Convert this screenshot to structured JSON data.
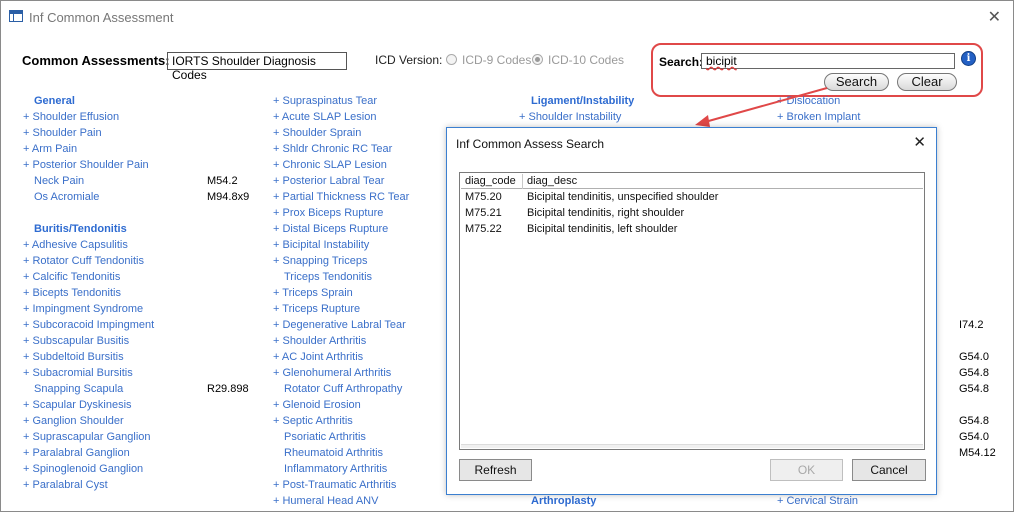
{
  "window": {
    "title": "Inf Common Assessment",
    "close_glyph": "✕"
  },
  "header": {
    "common_label": "Common Assessments:",
    "common_value": "IORTS Shoulder Diagnosis Codes",
    "icd_label": "ICD Version:",
    "icd9_label": "ICD-9 Codes",
    "icd10_label": "ICD-10 Codes",
    "icd_selected": "ICD-10 Codes"
  },
  "search": {
    "label": "Search:",
    "value": "bicipit",
    "info_glyph": "i",
    "search_button": "Search",
    "clear_button": "Clear"
  },
  "col1": [
    {
      "type": "section",
      "text": "General"
    },
    {
      "type": "link",
      "text": "+ Shoulder Effusion"
    },
    {
      "type": "link",
      "text": "+ Shoulder Pain"
    },
    {
      "type": "link",
      "text": "+ Arm Pain"
    },
    {
      "type": "link",
      "text": "+ Posterior Shoulder Pain"
    },
    {
      "type": "item",
      "text": "Neck Pain",
      "code": "M54.2"
    },
    {
      "type": "item",
      "text": "Os Acromiale",
      "code": "M94.8x9"
    },
    {
      "type": "blank",
      "text": ""
    },
    {
      "type": "section",
      "text": "Buritis/Tendonitis"
    },
    {
      "type": "link",
      "text": "+ Adhesive Capsulitis"
    },
    {
      "type": "link",
      "text": "+ Rotator Cuff Tendonitis"
    },
    {
      "type": "link",
      "text": "+ Calcific Tendonitis"
    },
    {
      "type": "link",
      "text": "+ Bicepts Tendonitis"
    },
    {
      "type": "link",
      "text": "+ Impingment Syndrome"
    },
    {
      "type": "link",
      "text": "+ Subcoracoid Impingment"
    },
    {
      "type": "link",
      "text": "+ Subscapular Busitis"
    },
    {
      "type": "link",
      "text": "+ Subdeltoid Bursitis"
    },
    {
      "type": "link",
      "text": "+ Subacromial Bursitis"
    },
    {
      "type": "item",
      "text": "Snapping Scapula",
      "code": "R29.898"
    },
    {
      "type": "link",
      "text": "+ Scapular Dyskinesis"
    },
    {
      "type": "link",
      "text": "+ Ganglion Shoulder"
    },
    {
      "type": "link",
      "text": "+ Suprascapular Ganglion"
    },
    {
      "type": "link",
      "text": "+ Paralabral Ganglion"
    },
    {
      "type": "link",
      "text": "+ Spinoglenoid Ganglion"
    },
    {
      "type": "link",
      "text": "+ Paralabral Cyst"
    }
  ],
  "col2": [
    {
      "type": "link",
      "text": "+ Supraspinatus Tear"
    },
    {
      "type": "link",
      "text": "+ Acute SLAP Lesion"
    },
    {
      "type": "link",
      "text": "+ Shoulder Sprain"
    },
    {
      "type": "link",
      "text": "+ Shldr Chronic RC Tear"
    },
    {
      "type": "link",
      "text": "+ Chronic SLAP Lesion"
    },
    {
      "type": "link",
      "text": "+ Posterior Labral Tear"
    },
    {
      "type": "link",
      "text": "+ Partial Thickness RC Tear"
    },
    {
      "type": "link",
      "text": "+ Prox Biceps Rupture"
    },
    {
      "type": "link",
      "text": "+ Distal Biceps Rupture"
    },
    {
      "type": "link",
      "text": "+ Bicipital Instability"
    },
    {
      "type": "link",
      "text": "+ Snapping Triceps"
    },
    {
      "type": "item",
      "text": "Triceps Tendonitis",
      "code": ""
    },
    {
      "type": "link",
      "text": "+ Triceps Sprain"
    },
    {
      "type": "link",
      "text": "+ Triceps Rupture"
    },
    {
      "type": "link",
      "text": "+ Degenerative Labral Tear"
    },
    {
      "type": "link",
      "text": "+ Shoulder Arthritis"
    },
    {
      "type": "link",
      "text": "+ AC Joint Arthritis"
    },
    {
      "type": "link",
      "text": "+ Glenohumeral Arthritis"
    },
    {
      "type": "item",
      "text": "Rotator Cuff Arthropathy",
      "code": ""
    },
    {
      "type": "link",
      "text": "+ Glenoid Erosion"
    },
    {
      "type": "link",
      "text": "+ Septic Arthritis"
    },
    {
      "type": "item",
      "text": "Psoriatic Arthritis",
      "code": ""
    },
    {
      "type": "item",
      "text": "Rheumatoid Arthritis",
      "code": ""
    },
    {
      "type": "item",
      "text": "Inflammatory Arthritis",
      "code": ""
    },
    {
      "type": "link",
      "text": "+ Post-Traumatic Arthritis"
    },
    {
      "type": "link",
      "text": "+ Humeral Head ANV"
    }
  ],
  "col3": {
    "section_top": "Ligament/Instability",
    "link_top": "+ Shoulder Instability",
    "section_bottom": "Arthroplasty"
  },
  "col4": {
    "link_top1": "+ Dislocation",
    "link_top2": "+ Broken Implant",
    "link_bottom": "+ Cervical Strain"
  },
  "right_codes": [
    {
      "row": 14,
      "code": "I74.2"
    },
    {
      "row": 16,
      "code": "G54.0"
    },
    {
      "row": 17,
      "code": "G54.8"
    },
    {
      "row": 18,
      "code": "G54.8"
    },
    {
      "row": 20,
      "code": "G54.8"
    },
    {
      "row": 21,
      "code": "G54.0"
    },
    {
      "row": 22,
      "code": "M54.12"
    }
  ],
  "dialog": {
    "title": "Inf Common Assess Search",
    "close_glyph": "✕",
    "columns": [
      "diag_code",
      "diag_desc"
    ],
    "rows": [
      [
        "M75.20",
        "Bicipital tendinitis, unspecified shoulder"
      ],
      [
        "M75.21",
        "Bicipital tendinitis, right shoulder"
      ],
      [
        "M75.22",
        "Bicipital tendinitis, left shoulder"
      ]
    ],
    "refresh_button": "Refresh",
    "ok_button": "OK",
    "cancel_button": "Cancel"
  },
  "colors": {
    "link": "#3a6fc9",
    "section": "#2e6bd1",
    "highlight": "#e04848"
  }
}
